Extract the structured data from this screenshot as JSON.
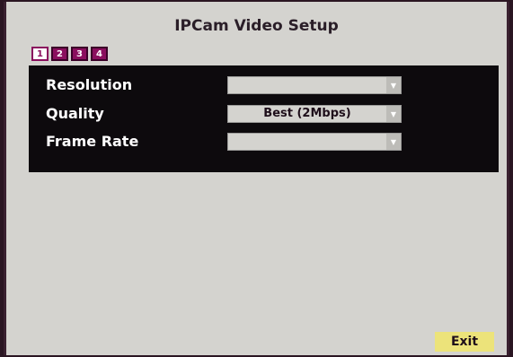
{
  "title": "IPCam Video Setup",
  "tabs": [
    {
      "label": "1",
      "active": true
    },
    {
      "label": "2",
      "active": false
    },
    {
      "label": "3",
      "active": false
    },
    {
      "label": "4",
      "active": false
    }
  ],
  "fields": {
    "resolution": {
      "label": "Resolution",
      "value": ""
    },
    "quality": {
      "label": "Quality",
      "value": "Best (2Mbps)"
    },
    "frame_rate": {
      "label": "Frame Rate",
      "value": ""
    }
  },
  "exit_label": "Exit",
  "colors": {
    "background": "#d4d3cf",
    "panel": "#0d0a0d",
    "tab": "#8a0f5e",
    "exit_button": "#ece37a"
  },
  "icons": {
    "dropdown": "chevron-down-icon"
  }
}
